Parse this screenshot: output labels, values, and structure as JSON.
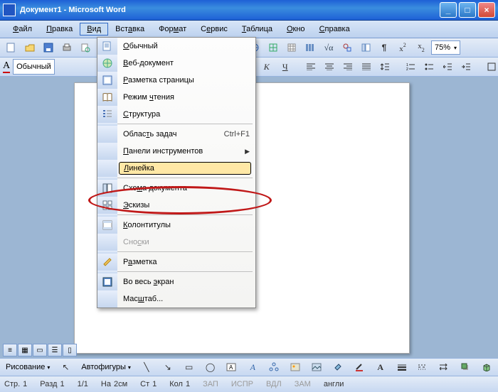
{
  "titlebar": {
    "doc": "Документ1",
    "app": "Microsoft Word"
  },
  "menubar": {
    "items": [
      {
        "label": "<u>Ф</u>айл"
      },
      {
        "label": "<u>П</u>равка"
      },
      {
        "label": "<u>В</u>ид",
        "open": true
      },
      {
        "label": "Вст<u>а</u>вка"
      },
      {
        "label": "Фор<u>м</u>ат"
      },
      {
        "label": "С<u>е</u>рвис"
      },
      {
        "label": "<u>Т</u>аблица"
      },
      {
        "label": "<u>О</u>кно"
      },
      {
        "label": "<u>С</u>правка"
      }
    ]
  },
  "toolbar1": {
    "zoom": "75%"
  },
  "formatbar": {
    "style": "Обычный"
  },
  "view_menu": {
    "items": [
      {
        "icon": "doc-normal",
        "label": "<u>О</u>бычный"
      },
      {
        "icon": "globe",
        "label": "<u>В</u>еб-документ"
      },
      {
        "icon": "page",
        "label": "<u>Р</u>азметка страницы"
      },
      {
        "icon": "book",
        "label": "Режим <u>ч</u>тения"
      },
      {
        "icon": "outline",
        "label": "<u>С</u>труктура"
      },
      {
        "sep": true
      },
      {
        "label": "Облас<u>т</u>ь задач",
        "short": "Ctrl+F1"
      },
      {
        "label": "<u>П</u>анели инструментов",
        "submenu": true
      },
      {
        "label": "<u>Л</u>инейка",
        "highlight": true
      },
      {
        "sep": true
      },
      {
        "icon": "schema",
        "label": "Схе<u>м</u>а документа"
      },
      {
        "icon": "thumbs",
        "label": "<u>Э</u>скизы"
      },
      {
        "sep": true
      },
      {
        "icon": "headerfooter",
        "label": "<u>К</u>олонтитулы"
      },
      {
        "label": "Сно<u>с</u>ки",
        "disabled": true
      },
      {
        "sep": true
      },
      {
        "icon": "markup",
        "label": "Р<u>а</u>зметка"
      },
      {
        "sep": true
      },
      {
        "icon": "fullscreen",
        "label": "Во весь <u>э</u>кран"
      },
      {
        "label": "Мас<u>ш</u>таб..."
      }
    ]
  },
  "drawbar": {
    "draw": "Рисование",
    "autoshapes": "Автофигуры"
  },
  "status": {
    "page_lbl": "Стр.",
    "page": "1",
    "sect_lbl": "Разд",
    "sect": "1",
    "pages": "1/1",
    "at_lbl": "На",
    "at": "2см",
    "ln_lbl": "Ст",
    "ln": "1",
    "col_lbl": "Кол",
    "col": "1",
    "modes": [
      "ЗАП",
      "ИСПР",
      "ВДЛ",
      "ЗАМ"
    ],
    "lang": "англи"
  }
}
